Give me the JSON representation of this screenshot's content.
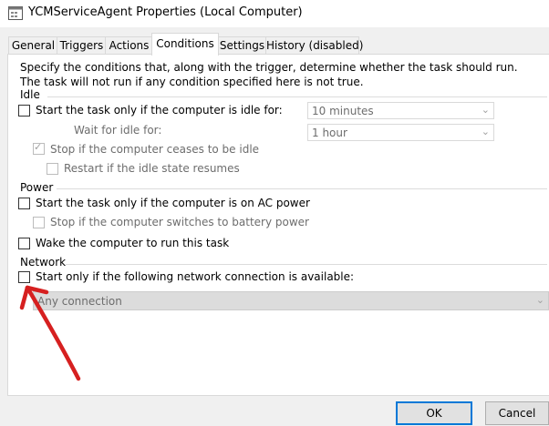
{
  "window": {
    "title": "YCMServiceAgent Properties (Local Computer)"
  },
  "tabs": [
    {
      "label": "General"
    },
    {
      "label": "Triggers"
    },
    {
      "label": "Actions"
    },
    {
      "label": "Conditions"
    },
    {
      "label": "Settings"
    },
    {
      "label": "History (disabled)"
    }
  ],
  "active_tab": "Conditions",
  "description": "Specify the conditions that, along with the trigger, determine whether the task should run.  The task will not run  if any condition specified here is not true.",
  "idle": {
    "group_label": "Idle",
    "start_if_idle": {
      "label": "Start the task only if the computer is idle for:",
      "checked": false
    },
    "idle_duration": "10 minutes",
    "wait_label": "Wait for idle for:",
    "wait_duration": "1 hour",
    "stop_if_not_idle": {
      "label": "Stop if the computer ceases to be idle",
      "checked": true
    },
    "restart_if_idle": {
      "label": "Restart if the idle state resumes",
      "checked": false
    }
  },
  "power": {
    "group_label": "Power",
    "ac_power": {
      "label": "Start the task only if the computer is on AC power",
      "checked": false
    },
    "battery_stop": {
      "label": "Stop if the computer switches to battery power",
      "checked": false
    },
    "wake": {
      "label": "Wake the computer to run this task",
      "checked": false
    }
  },
  "network": {
    "group_label": "Network",
    "network_available": {
      "label": "Start only if the following network connection is available:",
      "checked": false
    },
    "connection": "Any connection"
  },
  "buttons": {
    "ok": "OK",
    "cancel": "Cancel"
  },
  "colors": {
    "annotation_arrow": "#d62020",
    "default_button_border": "#0078d7"
  }
}
